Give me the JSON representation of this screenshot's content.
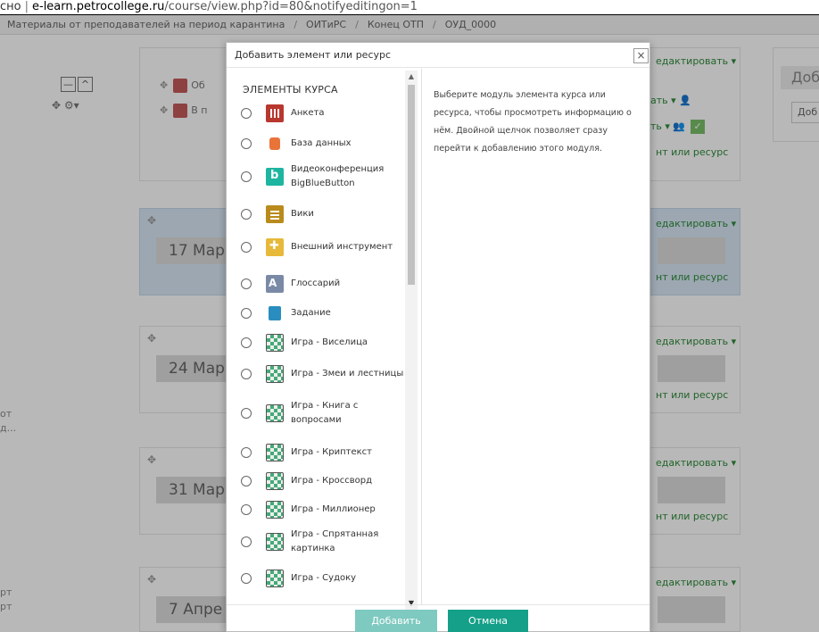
{
  "addressbar": {
    "security_text": "сно",
    "url_host": "e-learn.petrocollege.ru",
    "url_path": "/course/view.php?id=80&notifyeditingon=1"
  },
  "breadcrumbs": [
    "Материалы от преподавателей на период карантина",
    "ОИТиРС",
    "Конец ОТП",
    "ОУД_0000"
  ],
  "background": {
    "top_activities": [
      "Об",
      "В п"
    ],
    "edit_label": "едактировать ▾",
    "add_label": "нт или ресурс",
    "menu_person": "ать ▾ 👤",
    "menu_group": "ть ▾ 👥",
    "check_mark": "✓",
    "sections": [
      {
        "date": "17 Мар"
      },
      {
        "date": "24 Мар"
      },
      {
        "date": "31 Мар"
      },
      {
        "date": "7 Апре"
      }
    ],
    "right_title": "Доб",
    "right_button": "Доб",
    "left_fragments": [
      "от",
      "д...",
      "рт",
      "рт"
    ]
  },
  "modal": {
    "title": "Добавить элемент или ресурс",
    "close_glyph": "×",
    "section_heading": "ЭЛЕМЕНТЫ КУРСА",
    "help_text": "Выберите модуль элемента курса или ресурса, чтобы просмотреть информацию о нём. Двойной щелчок позволяет сразу перейти к добавлению этого модуля.",
    "options": [
      {
        "label": "Анкета",
        "icon": "survey-icon"
      },
      {
        "label": "База данных",
        "icon": "database-icon"
      },
      {
        "label": "Видеоконференция BigBlueButton",
        "icon": "bigbluebutton-icon"
      },
      {
        "label": "Вики",
        "icon": "wiki-icon"
      },
      {
        "label": "Внешний инструмент",
        "icon": "external-tool-icon"
      },
      {
        "label": "Глоссарий",
        "icon": "glossary-icon"
      },
      {
        "label": "Задание",
        "icon": "assignment-icon"
      },
      {
        "label": "Игра - Виселица",
        "icon": "game-icon"
      },
      {
        "label": "Игра - Змеи и лестницы",
        "icon": "game-icon"
      },
      {
        "label": "Игра - Книга с вопросами",
        "icon": "game-icon"
      },
      {
        "label": "Игра - Криптекст",
        "icon": "game-icon"
      },
      {
        "label": "Игра - Кроссворд",
        "icon": "game-icon"
      },
      {
        "label": "Игра - Миллионер",
        "icon": "game-icon"
      },
      {
        "label": "Игра - Спрятанная картинка",
        "icon": "game-icon"
      },
      {
        "label": "Игра - Судоку",
        "icon": "game-icon"
      }
    ],
    "add_button": "Добавить",
    "cancel_button": "Отмена"
  },
  "colors": {
    "accent": "#15a089",
    "accent_disabled": "#7ec9c0",
    "link_green": "#2e8b3a"
  }
}
